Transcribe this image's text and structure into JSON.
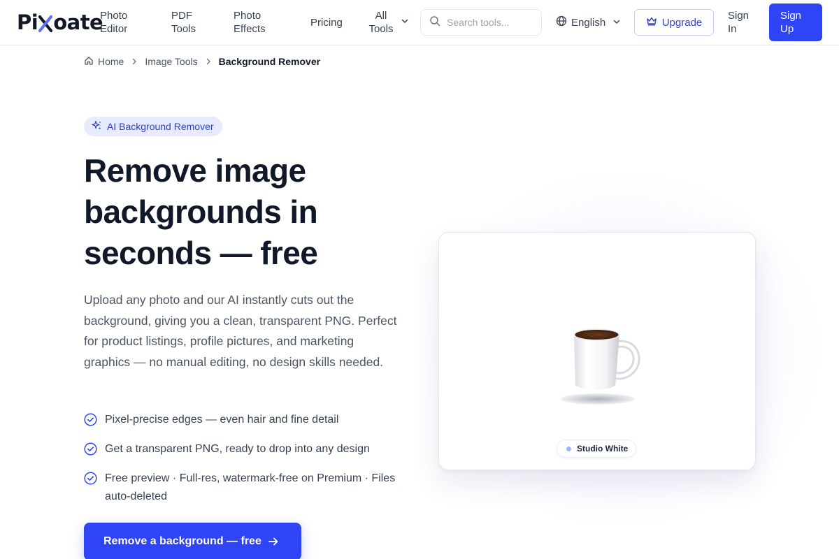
{
  "brand": {
    "name_start": "Pi",
    "name_end": "oate",
    "name_full": "Pixoate",
    "accent": "#2f45f5",
    "x_gradient": [
      "#3b82f6",
      "#8b5cf6"
    ]
  },
  "nav": {
    "photo_editor": "Photo Editor",
    "pdf_tools": "PDF Tools",
    "photo_effects": "Photo Effects",
    "pricing": "Pricing",
    "all_tools": "All Tools",
    "search_placeholder": "Search tools...",
    "language": "English",
    "upgrade": "Upgrade",
    "sign_in": "Sign In",
    "sign_up": "Sign Up"
  },
  "breadcrumb": {
    "home": "Home",
    "section": "Image Tools",
    "current": "Background Remover"
  },
  "hero": {
    "badge": "AI Background Remover",
    "title": "Remove image backgrounds in seconds — free",
    "description": "Upload any photo and our AI instantly cuts out the background, giving you a clean, transparent PNG. Perfect for product listings, profile pictures, and marketing graphics — no manual editing, no design skills needed.",
    "features": [
      "Pixel-precise edges — even hair and fine detail",
      "Get a transparent PNG, ready to drop into any design",
      "Free preview · Full-res, watermark-free on Premium · Files auto-deleted"
    ],
    "cta": "Remove a background — free"
  },
  "preview": {
    "chip_label": "Studio White",
    "chip_color": "#a5b4fc"
  },
  "icons": {
    "search": "search-icon",
    "globe": "globe-icon",
    "crown": "crown-icon",
    "home": "home-icon",
    "sparkles": "sparkles-icon",
    "check_circle": "check-circle-icon",
    "arrow_right": "arrow-right-icon",
    "chevron_down": "chevron-down-icon",
    "chevron_right": "chevron-right-icon"
  }
}
